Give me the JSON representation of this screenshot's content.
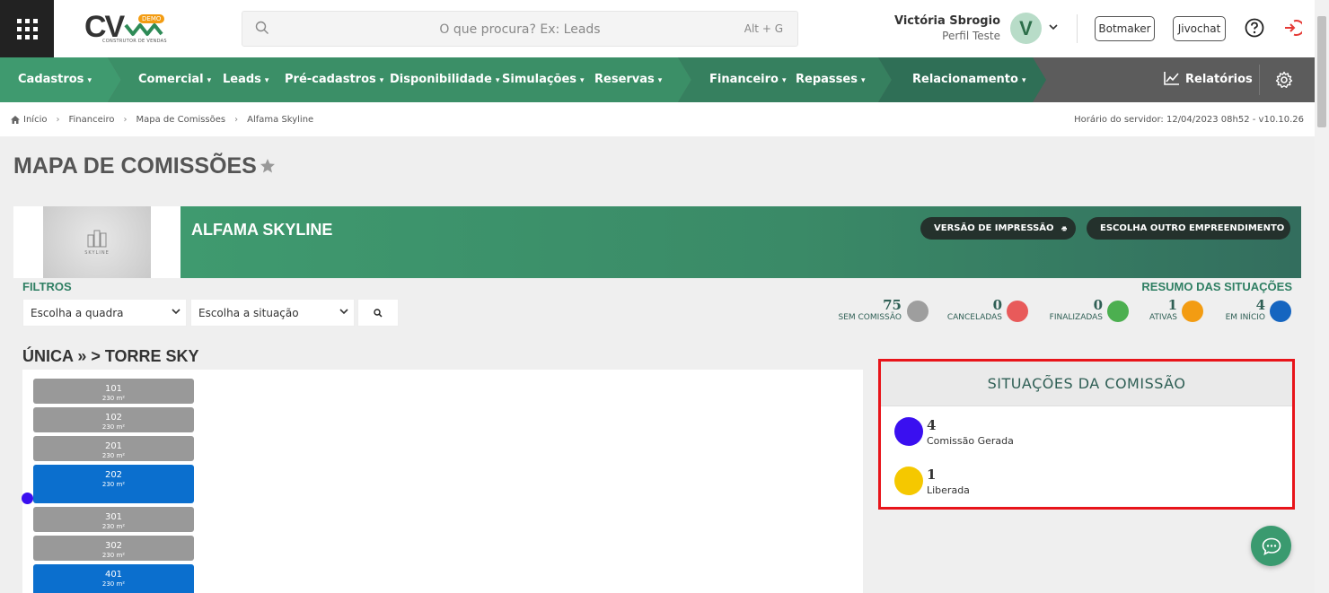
{
  "header": {
    "logo_text": "CV",
    "logo_badge": "DEMO",
    "logo_sub": "CONSTRUTOR DE VENDAS",
    "search_placeholder": "O que procura? Ex: Leads",
    "search_shortcut": "Alt + G",
    "user_name": "Victória Sbrogio",
    "user_role": "Perfil Teste",
    "avatar_letter": "V",
    "botmaker_label": "Botmaker",
    "jivochat_label": "Jivochat"
  },
  "nav": {
    "items": [
      {
        "label": "Cadastros"
      },
      {
        "label": "Comercial"
      },
      {
        "label": "Leads"
      },
      {
        "label": "Pré-cadastros"
      },
      {
        "label": "Disponibilidade"
      },
      {
        "label": "Simulações"
      },
      {
        "label": "Reservas"
      },
      {
        "label": "Financeiro"
      },
      {
        "label": "Repasses"
      },
      {
        "label": "Relacionamento"
      }
    ],
    "reports_label": "Relatórios",
    "colors": {
      "seg1": "#3f9a6f",
      "seg2": "#3b8f67",
      "seg3": "#36805f",
      "seg4": "#2f6f56",
      "rest": "#5c5c5c"
    }
  },
  "breadcrumb": {
    "items": [
      "Início",
      "Financeiro",
      "Mapa de Comissões",
      "Alfama Skyline"
    ],
    "server_time": "Horário do servidor: 12/04/2023 08h52 - v10.10.26"
  },
  "page": {
    "title": "MAPA DE COMISSÕES"
  },
  "project": {
    "name": "ALFAMA SKYLINE",
    "image_caption": "SKYLINE",
    "print_label": "VERSÃO DE IMPRESSÃO",
    "choose_label": "ESCOLHA OUTRO EMPREENDIMENTO"
  },
  "filters": {
    "label": "FILTROS",
    "quadra_value": "Escolha a quadra",
    "situacao_value": "Escolha a situação"
  },
  "summary": {
    "label": "RESUMO DAS SITUAÇÕES",
    "items": [
      {
        "count": "75",
        "label": "SEM COMISSÃO",
        "color": "#9e9e9e"
      },
      {
        "count": "0",
        "label": "CANCELADAS",
        "color": "#e85a5a"
      },
      {
        "count": "0",
        "label": "FINALIZADAS",
        "color": "#4caf50"
      },
      {
        "count": "1",
        "label": "ATIVAS",
        "color": "#f39c12"
      },
      {
        "count": "4",
        "label": "EM INÍCIO",
        "color": "#1565c0"
      }
    ]
  },
  "tower": {
    "title": "ÚNICA » > TORRE SKY",
    "units": [
      {
        "number": "101",
        "area": "230 m²",
        "color": "#999999"
      },
      {
        "number": "102",
        "area": "230 m²",
        "color": "#999999"
      },
      {
        "number": "201",
        "area": "230 m²",
        "color": "#999999"
      },
      {
        "number": "202",
        "area": "230 m²",
        "color": "#0b6fce"
      },
      {
        "number": "301",
        "area": "230 m²",
        "color": "#999999"
      },
      {
        "number": "302",
        "area": "230 m²",
        "color": "#999999"
      },
      {
        "number": "401",
        "area": "230 m²",
        "color": "#0b6fce"
      }
    ],
    "marker_color": "#3a0ff0"
  },
  "status_panel": {
    "title": "SITUAÇÕES DA COMISSÃO",
    "items": [
      {
        "count": "4",
        "label": "Comissão Gerada",
        "color": "#3a0ff0"
      },
      {
        "count": "1",
        "label": "Liberada",
        "color": "#f5c800"
      }
    ]
  }
}
